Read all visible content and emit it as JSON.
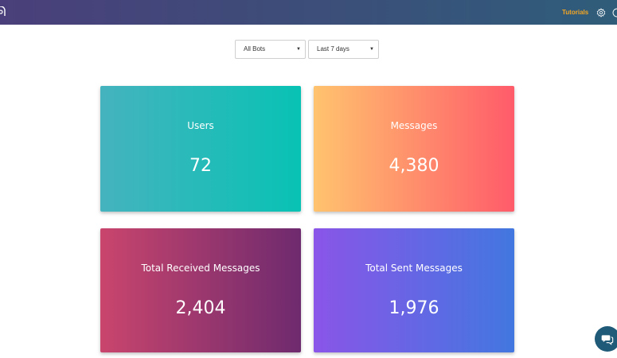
{
  "header": {
    "tutorials_label": "Tutorials",
    "icons": [
      "logo-icon",
      "gear-icon",
      "user-icon"
    ],
    "accent_color": "#f5a623"
  },
  "filters": {
    "bot_select": {
      "value": "All Bots"
    },
    "range_select": {
      "value": "Last 7 days"
    }
  },
  "stats": [
    {
      "label": "Users",
      "value": "72"
    },
    {
      "label": "Messages",
      "value": "4,380"
    },
    {
      "label": "Total Received Messages",
      "value": "2,404"
    },
    {
      "label": "Total Sent Messages",
      "value": "1,976"
    }
  ],
  "chat": {
    "icon": "chat-icon"
  }
}
